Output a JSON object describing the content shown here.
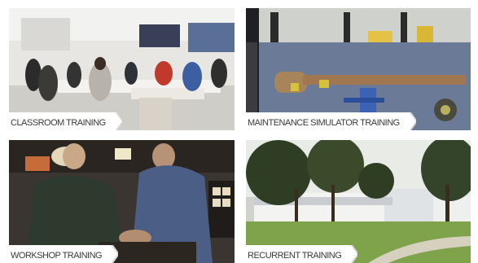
{
  "tiles": [
    {
      "caption": "CLASSROOM TRAINING",
      "icon": "classroom-photo"
    },
    {
      "caption": "MAINTENANCE SIMULATOR TRAINING",
      "icon": "maintenance-simulator-photo"
    },
    {
      "caption": "WORKSHOP TRAINING",
      "icon": "workshop-photo"
    },
    {
      "caption": "RECURRENT TRAINING",
      "icon": "recurrent-training-photo"
    }
  ]
}
